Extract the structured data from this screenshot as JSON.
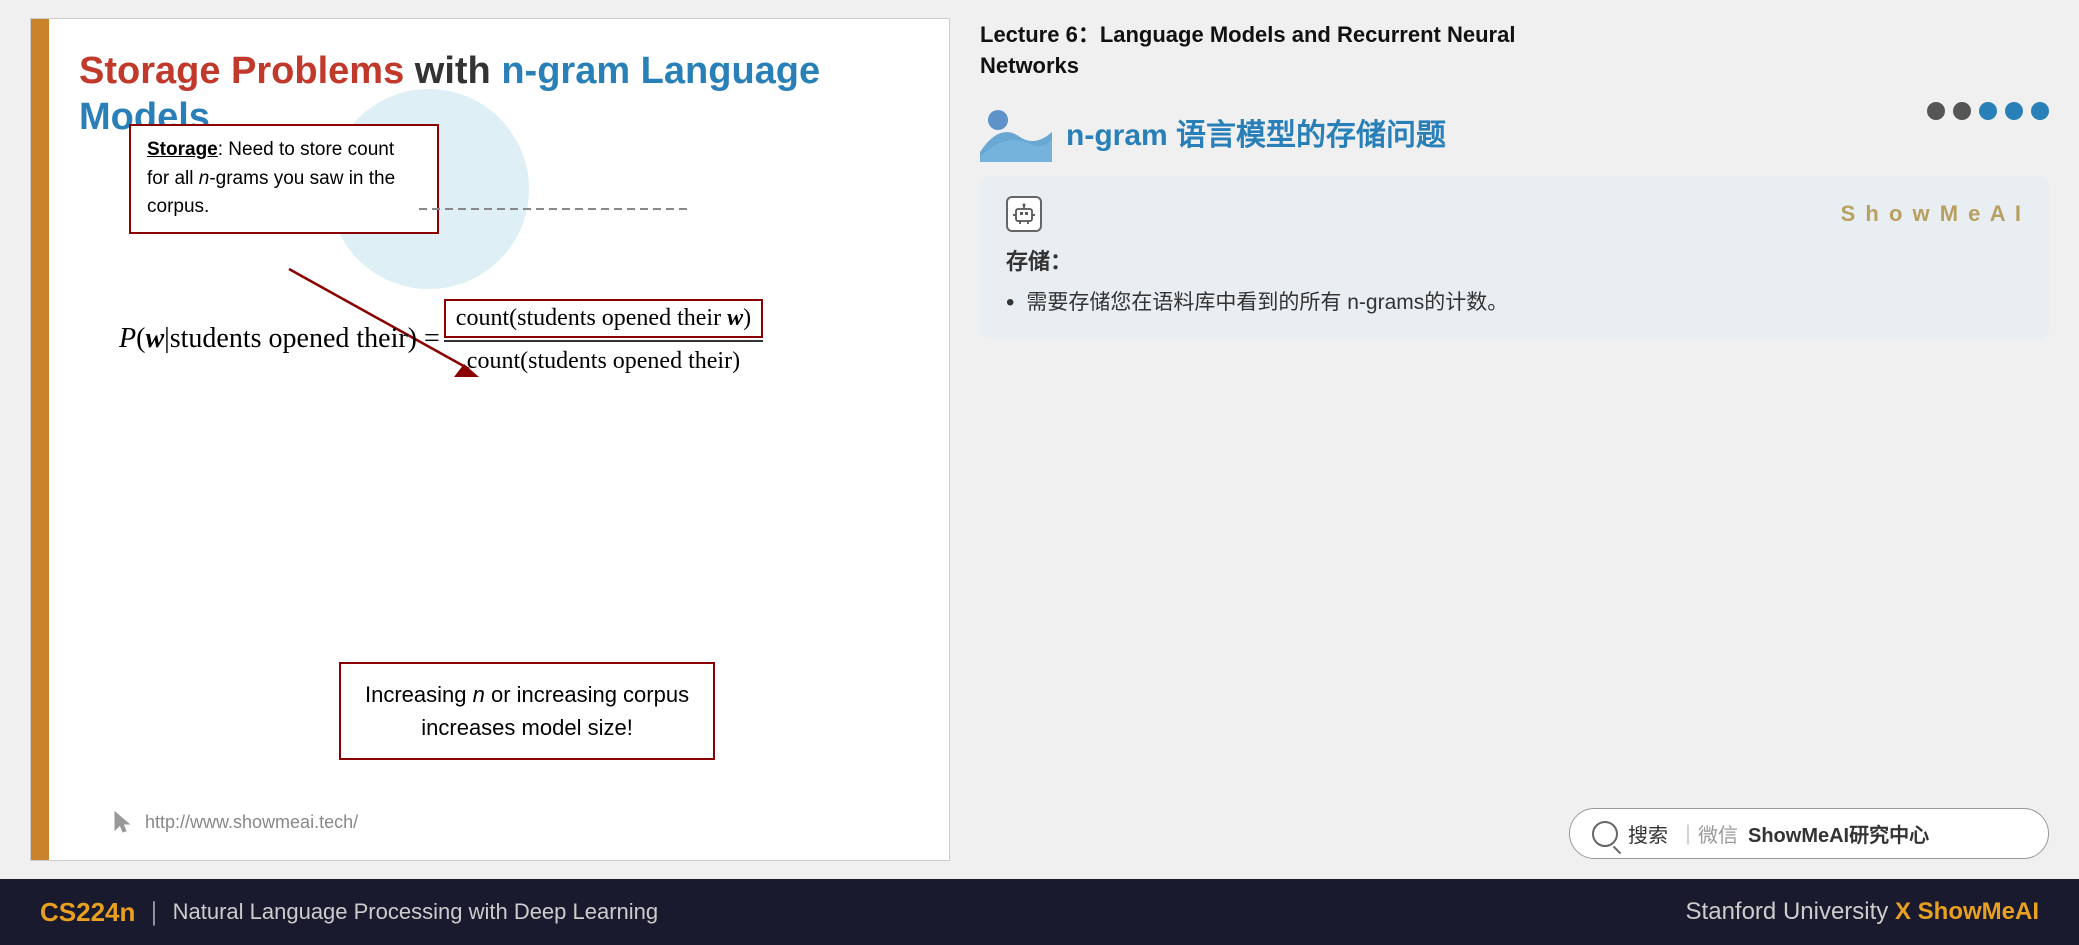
{
  "slide": {
    "title": {
      "part1": "Storage Problems",
      "part2": " with ",
      "part3": "n-gram Language Models"
    },
    "storage_box": {
      "label": "Storage",
      "text": ": Need to store count for all ",
      "italic": "n",
      "text2": "-grams you saw in the corpus."
    },
    "formula": {
      "lhs": "P(",
      "w_bold": "w",
      "lhs2": "|students opened their) =",
      "numerator": "count(students opened their ",
      "num_w": "w",
      "num_close": ")",
      "denominator": "count(students opened their)"
    },
    "increasing_box": {
      "line1": "Increasing ",
      "italic_n": "n",
      "line1b": " or increasing corpus",
      "line2": "increases model size!"
    },
    "url": "http://www.showmeai.tech/"
  },
  "right_panel": {
    "lecture_title": "Lecture 6：Language Models and Recurrent Neural\nNetworks",
    "ngram_title": "n-gram 语言模型的存储问题",
    "dots": [
      "#444",
      "#444",
      "#2980b9",
      "#2980b9",
      "#2980b9"
    ],
    "showmeai_label": "S h o w M e A I",
    "card": {
      "storage_heading": "存储：",
      "bullet": "需要存储您在语料库中看到的所有 n-grams的计数。"
    },
    "search": {
      "icon_label": "搜索",
      "separator": "｜微信",
      "brand": "ShowMeAI研究中心"
    }
  },
  "footer": {
    "cs224n": "CS224n",
    "separator": "|",
    "course": "Natural Language Processing with Deep Learning",
    "right_text": "Stanford University",
    "x_label": "X",
    "showmeai": "ShowMeAI"
  }
}
